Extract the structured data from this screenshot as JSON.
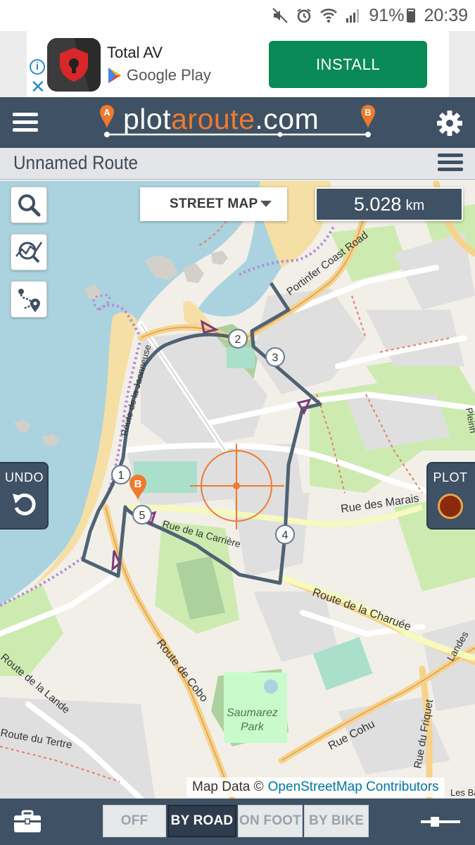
{
  "status_bar": {
    "battery": "91%",
    "time": "20:39"
  },
  "ad": {
    "app_name": "Total AV",
    "store": "Google Play",
    "install_label": "INSTALL",
    "info_glyph": "i",
    "close_glyph": "✕"
  },
  "header": {
    "logo_part1": "plot",
    "logo_part2": "a",
    "logo_part3": "route",
    "logo_part4": ".com",
    "logo_pin_a": "A",
    "logo_pin_b": "B"
  },
  "route": {
    "title": "Unnamed Route"
  },
  "map": {
    "layer_select": "STREET MAP",
    "distance_value": "5.028",
    "distance_unit": "km",
    "undo_label": "UNDO",
    "plot_label": "PLOT",
    "attribution_prefix": "Map Data ©",
    "attribution_link": "OpenStreetMap Contributors",
    "waypoints": [
      "1",
      "2",
      "3",
      "4",
      "5"
    ],
    "end_marker": "B",
    "labels": {
      "portinfer": "Portinfer Coast Road",
      "marais": "Rue des Marais",
      "charuee": "Route de la Charuée",
      "cobo": "Route de Cobo",
      "lande": "Route de la Lande",
      "tertre": "Route du Tertre",
      "saumarez1": "Saumarez",
      "saumarez2": "Park",
      "cohu": "Rue Cohu",
      "friquet": "Rue du Friquet",
      "carriere": "Rue de la Carrière",
      "coast": "Route de la Jaonneuse",
      "landes": "Landes",
      "pleinh": "Pleinh",
      "lesbains": "Les Bai"
    }
  },
  "modes": {
    "off": "OFF",
    "by_road": "BY ROAD",
    "on_foot": "ON FOOT",
    "by_bike": "BY BIKE"
  }
}
